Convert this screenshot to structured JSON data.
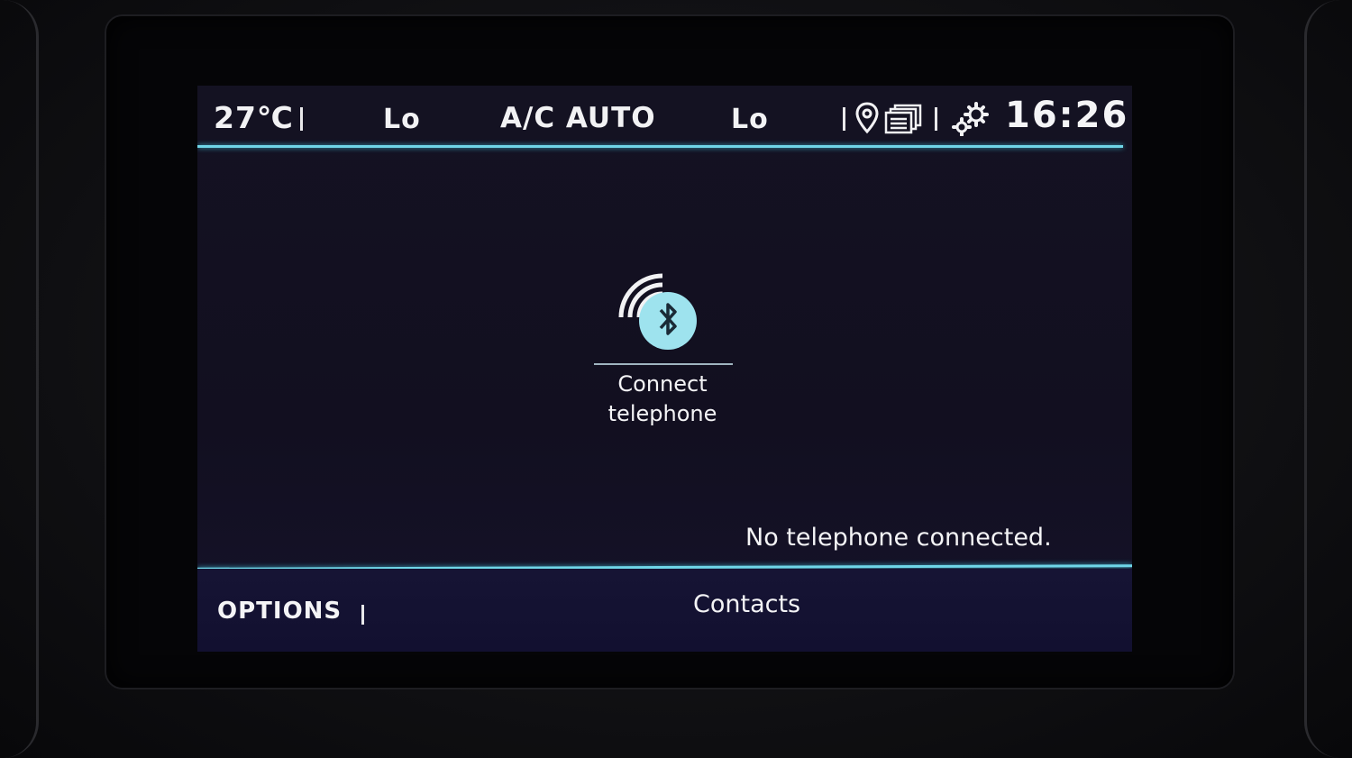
{
  "statusbar": {
    "temperature": "27℃",
    "fan_left": "Lo",
    "ac_mode": "A/C AUTO",
    "fan_right": "Lo",
    "clock": "16:26"
  },
  "main": {
    "connect_label_line1": "Connect",
    "connect_label_line2": "telephone",
    "status_message": "No telephone connected."
  },
  "bottombar": {
    "options_label": "OPTIONS",
    "contacts_label": "Contacts"
  },
  "colors": {
    "accent": "#6fd6e8",
    "bluetooth_circle": "#9ee3ee",
    "text": "#f4f4f6",
    "screen_bg": "#141222"
  }
}
